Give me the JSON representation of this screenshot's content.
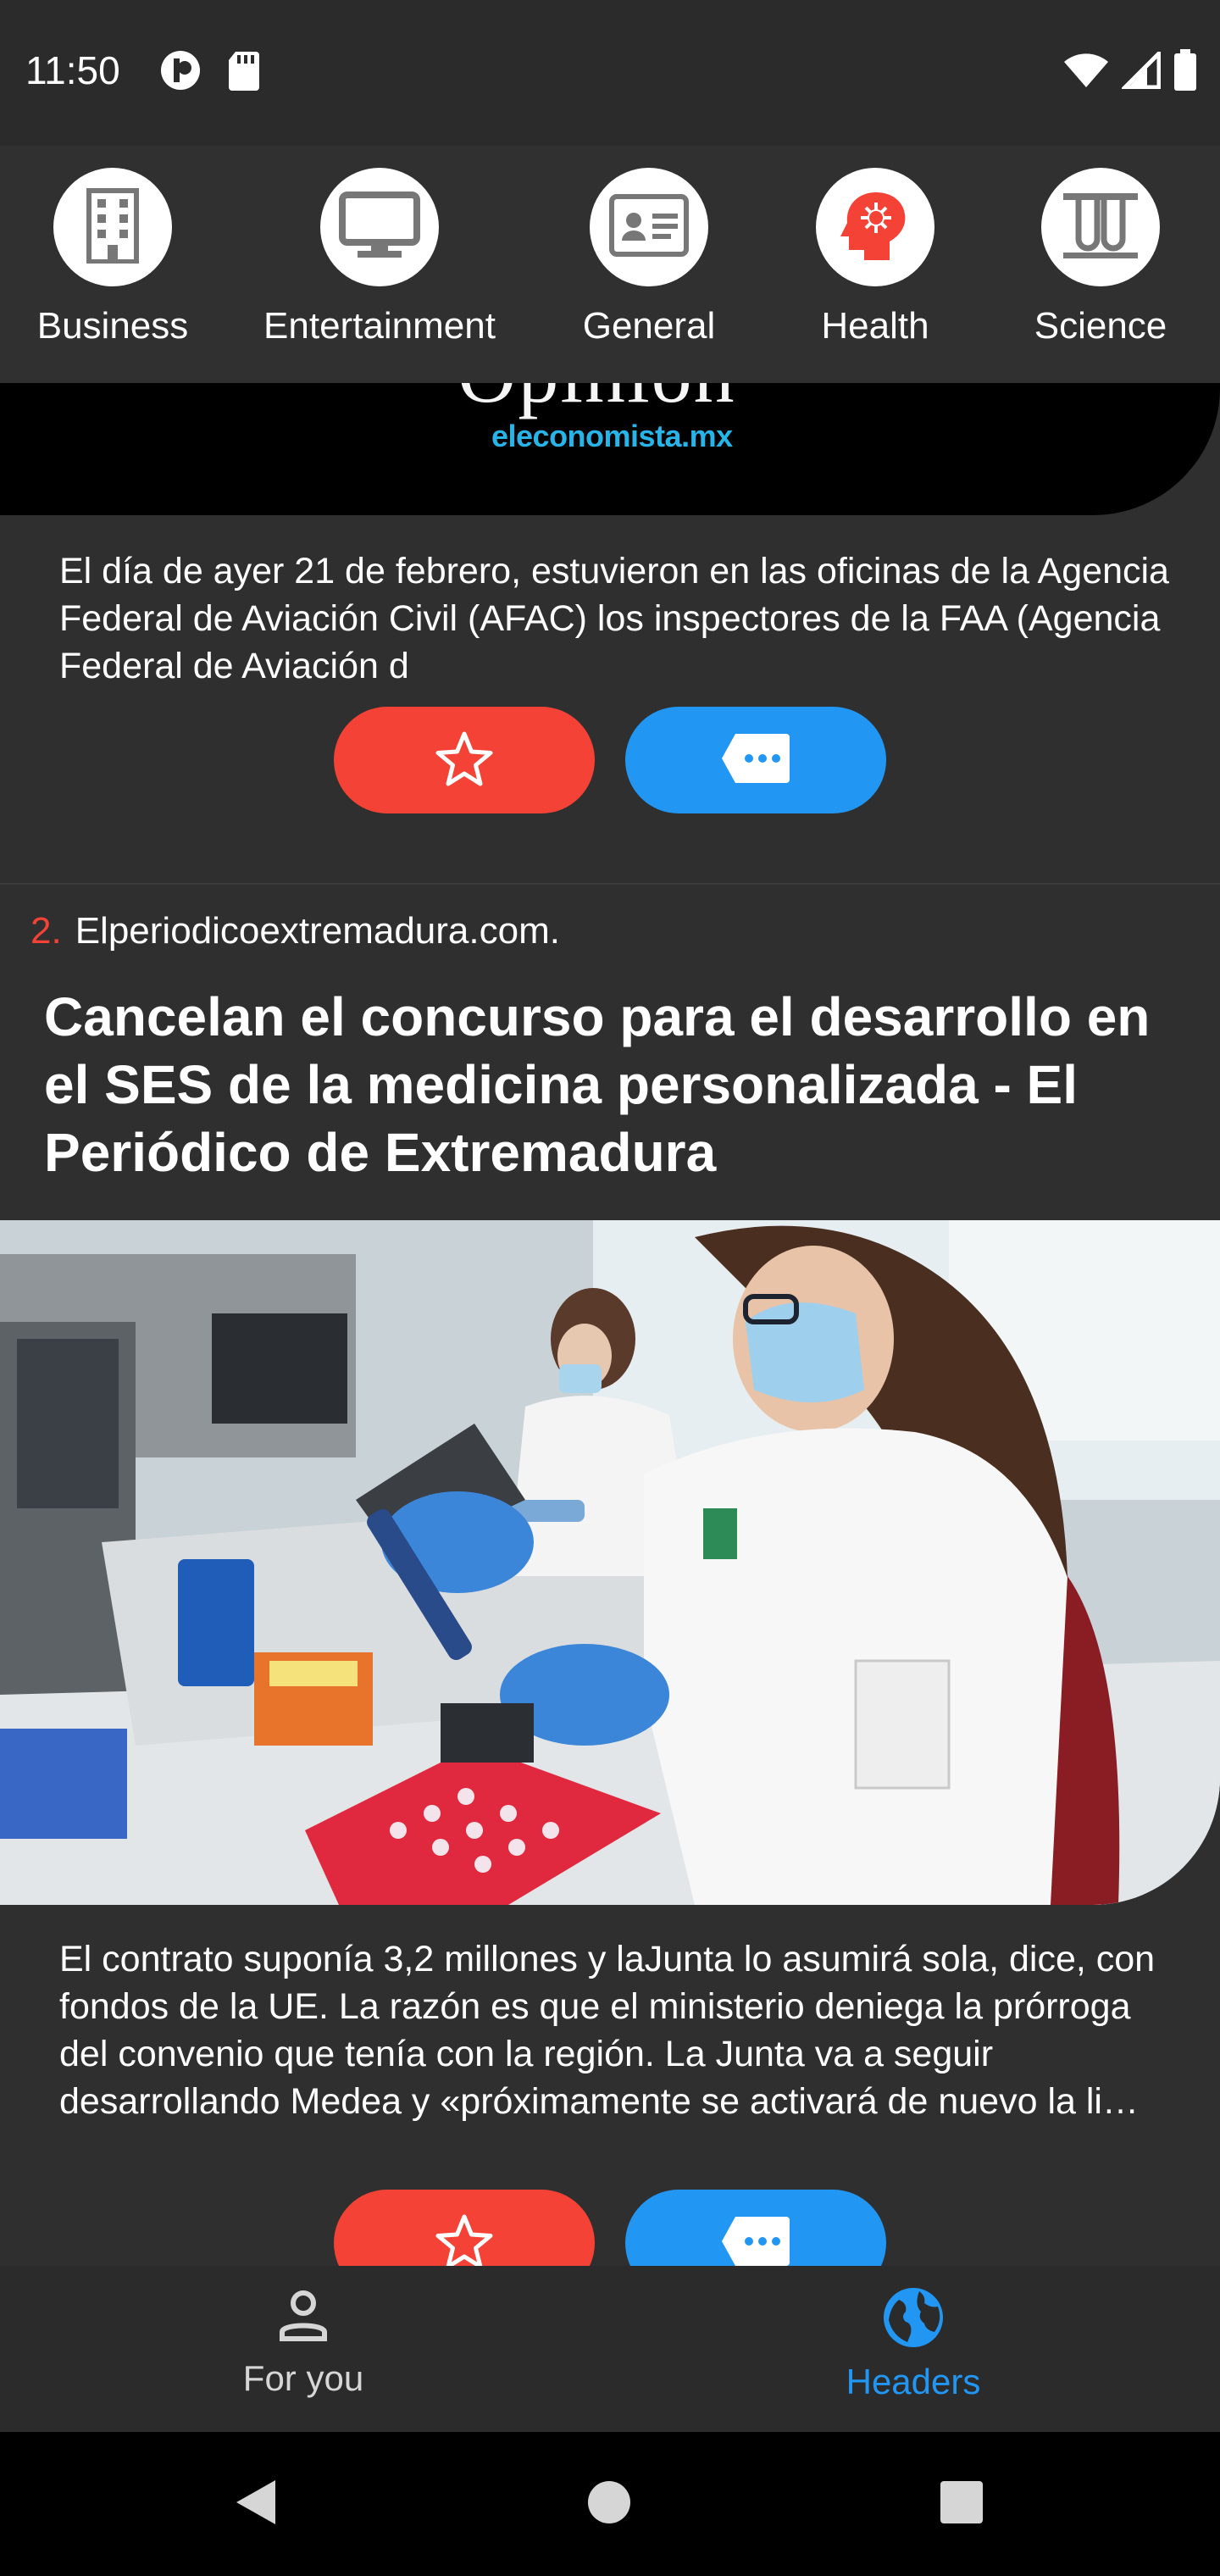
{
  "status_bar": {
    "time": "11:50",
    "left_icons": [
      "circle-app-icon",
      "sd-card-icon"
    ],
    "right_icons": [
      "wifi-icon",
      "signal-icon",
      "battery-icon"
    ]
  },
  "categories": [
    {
      "label": "Business",
      "icon": "building-icon"
    },
    {
      "label": "Entertainment",
      "icon": "monitor-icon"
    },
    {
      "label": "General",
      "icon": "id-card-icon"
    },
    {
      "label": "Health",
      "icon": "virus-head-icon"
    },
    {
      "label": "Science",
      "icon": "test-tubes-icon"
    }
  ],
  "articles": [
    {
      "image_partial_text": "Opinión",
      "image_logo_text": "eleconomista.mx",
      "description": "El día de ayer 21 de febrero, estuvieron en las oficinas de la Agencia Federal de Aviación Civil (AFAC) los inspectores de la FAA (Agencia Federal de Aviación d"
    },
    {
      "rank": "2.",
      "source": "Elperiodicoextremadura.com.",
      "title": "Cancelan el concurso para el desarrollo en el SES de la medicina personalizada - El Periódico de Extremadura",
      "description": "El contrato suponía 3,2 millones y laJunta lo asumirá sola, dice, con fondos de la UE.  La razón es que el ministerio deniega la prórroga del convenio que tenía con la región. La Junta va a seguir desarrollando Medea y «próximamente se activará de nuevo la li…"
    }
  ],
  "bottom_nav": [
    {
      "label": "For you",
      "icon": "person-icon",
      "active": false
    },
    {
      "label": "Headers",
      "icon": "globe-icon",
      "active": true
    }
  ],
  "colors": {
    "accent_red": "#f44336",
    "accent_blue": "#2196f3",
    "nav_active": "#2196f3",
    "nav_inactive": "#d6d6d6",
    "logo_cyan": "#27b4e8"
  }
}
